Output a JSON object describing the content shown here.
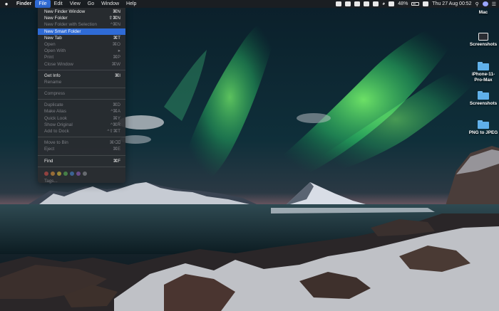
{
  "menubar": {
    "app_name": "Finder",
    "items": [
      "File",
      "Edit",
      "View",
      "Go",
      "Window",
      "Help"
    ],
    "active_item": "File",
    "battery_text": "48%",
    "clock_text": "Thu 27 Aug  00:52"
  },
  "file_menu": {
    "groups": [
      [
        {
          "label": "New Finder Window",
          "shortcut": "⌘N",
          "enabled": true
        },
        {
          "label": "New Folder",
          "shortcut": "⇧⌘N",
          "enabled": true
        },
        {
          "label": "New Folder with Selection",
          "shortcut": "^⌘N",
          "enabled": false
        },
        {
          "label": "New Smart Folder",
          "shortcut": "",
          "enabled": true,
          "highlighted": true
        },
        {
          "label": "New Tab",
          "shortcut": "⌘T",
          "enabled": true
        },
        {
          "label": "Open",
          "shortcut": "⌘O",
          "enabled": false
        },
        {
          "label": "Open With",
          "shortcut": "▸",
          "enabled": false
        },
        {
          "label": "Print",
          "shortcut": "⌘P",
          "enabled": false
        },
        {
          "label": "Close Window",
          "shortcut": "⌘W",
          "enabled": false
        }
      ],
      [
        {
          "label": "Get Info",
          "shortcut": "⌘I",
          "enabled": true
        },
        {
          "label": "Rename",
          "shortcut": "",
          "enabled": false
        }
      ],
      [
        {
          "label": "Compress",
          "shortcut": "",
          "enabled": false
        }
      ],
      [
        {
          "label": "Duplicate",
          "shortcut": "⌘D",
          "enabled": false
        },
        {
          "label": "Make Alias",
          "shortcut": "^⌘A",
          "enabled": false
        },
        {
          "label": "Quick Look",
          "shortcut": "⌘Y",
          "enabled": false
        },
        {
          "label": "Show Original",
          "shortcut": "^⌘R",
          "enabled": false
        },
        {
          "label": "Add to Dock",
          "shortcut": "^⇧⌘T",
          "enabled": false
        }
      ],
      [
        {
          "label": "Move to Bin",
          "shortcut": "⌘⌫",
          "enabled": false
        },
        {
          "label": "Eject",
          "shortcut": "⌘E",
          "enabled": false
        }
      ],
      [
        {
          "label": "Find",
          "shortcut": "⌘F",
          "enabled": true
        }
      ]
    ],
    "tag_colors": [
      "#e8524a",
      "#f2a03d",
      "#f5d33f",
      "#5fc35a",
      "#4a90e2",
      "#a066d3",
      "#9a9ca2"
    ],
    "tags_label": "Tags..."
  },
  "desktop_items": [
    {
      "label": "Mac",
      "icon": "drive-icon"
    },
    {
      "label": "Screenshots",
      "icon": "monitor-icon"
    },
    {
      "label": "iPhone-11-Pro-Max",
      "icon": "folder-icon"
    },
    {
      "label": "Screenshots",
      "icon": "folder-icon"
    },
    {
      "label": "PNG to JPEG",
      "icon": "folder-icon"
    }
  ]
}
